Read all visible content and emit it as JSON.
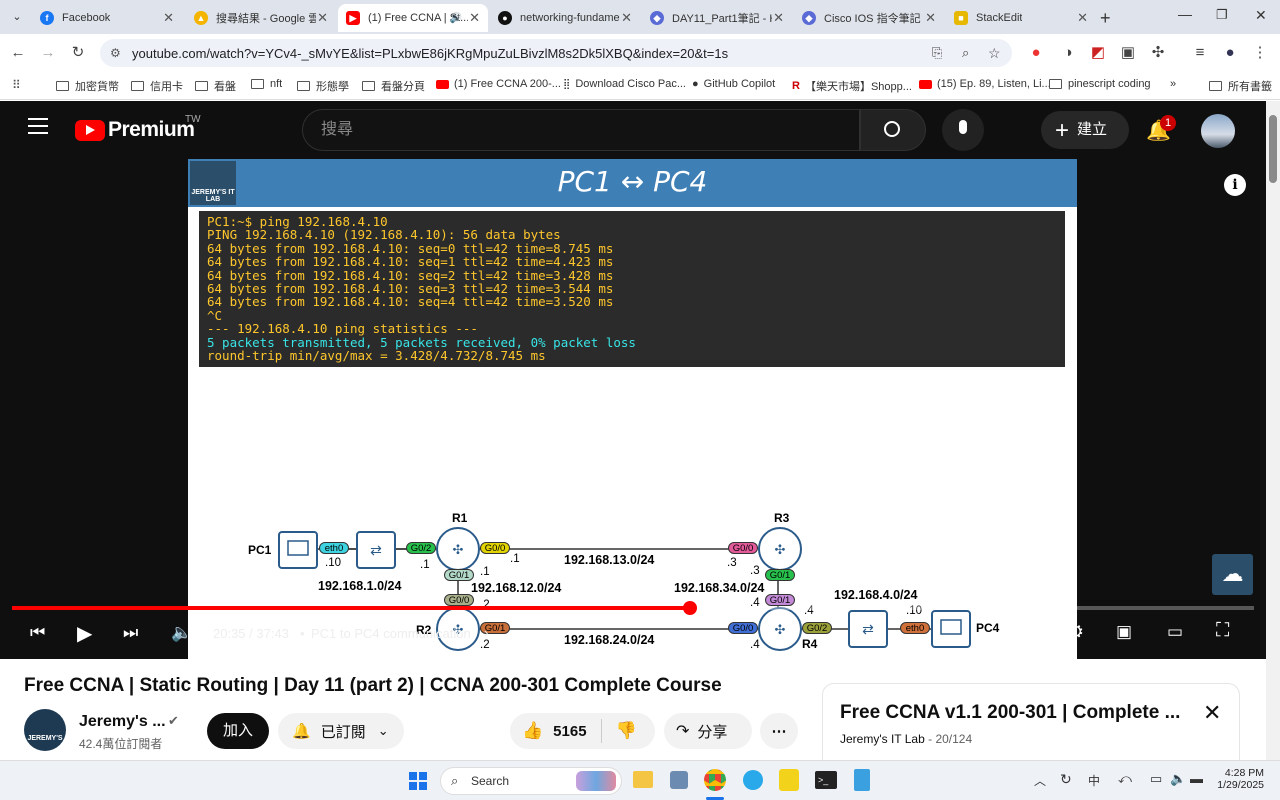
{
  "tabs": [
    {
      "title": "Facebook",
      "icon": "facebook-icon",
      "color": "#1877f2"
    },
    {
      "title": "搜尋結果 - Google 雲...",
      "icon": "google-drive-icon",
      "color": "#f4b400"
    },
    {
      "title": "(1) Free CCNA | St...",
      "icon": "youtube-icon",
      "color": "#ff0000",
      "active": true
    },
    {
      "title": "networking-fundame...",
      "icon": "github-icon",
      "color": "#111"
    },
    {
      "title": "DAY11_Part1筆記 - H...",
      "icon": "hackmd-icon",
      "color": "#5b6bd6"
    },
    {
      "title": "Cisco IOS 指令筆記 ...",
      "icon": "hackmd-icon",
      "color": "#5b6bd6"
    },
    {
      "title": "StackEdit",
      "icon": "stackedit-icon",
      "color": "#e6b800"
    }
  ],
  "address": {
    "url": "youtube.com/watch?v=YCv4-_sMvYE&list=PLxbwE86jKRgMpuZuLBivzlM8s2Dk5lXBQ&index=20&t=1s"
  },
  "bookmarks": [
    "加密貨幣",
    "信用卡",
    "看盤",
    "nft",
    "形態學",
    "看盤分頁",
    "(1) Free CCNA 200-...",
    "Download Cisco Pac...",
    "GitHub Copilot",
    "【樂天市場】Shopp...",
    "(15) Ep. 89, Listen, Li...",
    "pinescript coding",
    "所有書籤"
  ],
  "youtube": {
    "logo": "Premium",
    "region": "TW",
    "search_placeholder": "搜尋",
    "create_label": "建立",
    "notif_count": "1"
  },
  "slide": {
    "title": "PC1 ↔ PC4",
    "logo_text": "JEREMY'S IT LAB",
    "terminal": [
      {
        "t": "PC1:~$ ping 192.168.4.10",
        "c": "cy"
      },
      {
        "t": "PING 192.168.4.10 (192.168.4.10): 56 data bytes",
        "c": "cy"
      },
      {
        "t": "64 bytes from 192.168.4.10: seq=0 ttl=42 time=8.745 ms",
        "c": "cy"
      },
      {
        "t": "64 bytes from 192.168.4.10: seq=1 ttl=42 time=4.423 ms",
        "c": "cy"
      },
      {
        "t": "64 bytes from 192.168.4.10: seq=2 ttl=42 time=3.428 ms",
        "c": "cy"
      },
      {
        "t": "64 bytes from 192.168.4.10: seq=3 ttl=42 time=3.544 ms",
        "c": "cy"
      },
      {
        "t": "64 bytes from 192.168.4.10: seq=4 ttl=42 time=3.520 ms",
        "c": "cy"
      },
      {
        "t": "^C",
        "c": "cy"
      },
      {
        "t": "--- 192.168.4.10 ping statistics ---",
        "c": "cy"
      },
      {
        "t": "5 packets transmitted, 5 packets received, 0% packet loss",
        "c": "cc"
      },
      {
        "t": "round-trip min/avg/max = 3.428/4.732/8.745 ms",
        "c": "cy"
      }
    ],
    "diagram": {
      "pc1": "PC1",
      "pc4": "PC4",
      "r1": "R1",
      "r2": "R2",
      "r3": "R3",
      "r4": "R4",
      "net1": "192.168.1.0/24",
      "net13": "192.168.13.0/24",
      "net12": "192.168.12.0/24",
      "net34": "192.168.34.0/24",
      "net24": "192.168.24.0/24",
      "net4": "192.168.4.0/24",
      "eth0": "eth0",
      "g02": "G0/2",
      "g00": "G0/0",
      "g01": "G0/1",
      "a10": ".10",
      "a1": ".1",
      "a3": ".3",
      "a2": ".2",
      "a4": ".4"
    }
  },
  "player": {
    "time": "20:35 / 37:43",
    "chapter": "PC1 to PC4 communication",
    "progress": 0.546
  },
  "video": {
    "title": "Free CCNA | Static Routing | Day 11 (part 2) | CCNA 200-301 Complete Course",
    "channel": "Jeremy's ...",
    "subscribers": "42.4萬位訂閱者",
    "join": "加入",
    "subscribed": "已訂閱",
    "likes": "5165",
    "share": "分享"
  },
  "playlist": {
    "title": "Free CCNA v1.1 200-301 | Complete ...",
    "owner": "Jeremy's IT Lab",
    "position": "20/124"
  },
  "taskbar": {
    "search": "Search",
    "time": "4:28 PM",
    "date": "1/29/2025",
    "ime": "中"
  }
}
